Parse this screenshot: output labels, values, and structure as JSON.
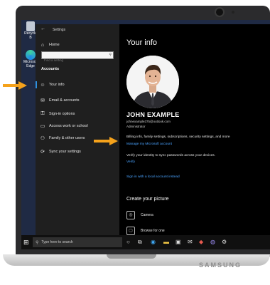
{
  "desktop": {
    "recycle_bin_label": "Recycle B",
    "edge_label": "Microsoft Edge"
  },
  "settings": {
    "window_title": "Settings",
    "nav": {
      "home_label": "Home",
      "search_placeholder": "Find a setting",
      "section_heading": "Accounts",
      "items": [
        {
          "label": "Your info",
          "icon": "person-card-icon"
        },
        {
          "label": "Email & accounts",
          "icon": "mail-icon"
        },
        {
          "label": "Sign-in options",
          "icon": "key-icon"
        },
        {
          "label": "Access work or school",
          "icon": "briefcase-icon"
        },
        {
          "label": "Family & other users",
          "icon": "people-icon"
        },
        {
          "label": "Sync your settings",
          "icon": "sync-icon"
        }
      ]
    },
    "content": {
      "title": "Your info",
      "user_name": "JOHN EXAMPLE",
      "user_email": "johnexample375@outlook.com",
      "user_role": "Administrator",
      "billing_text": "Billing info, family settings, subscriptions, security settings, and more",
      "manage_link": "Manage my Microsoft account",
      "verify_text": "Verify your identity to sync passwords across your devices.",
      "verify_link": "Verify",
      "local_link": "Sign in with a local account instead",
      "create_heading": "Create your picture",
      "camera_option": "Camera",
      "browse_option": "Browse for one"
    }
  },
  "taskbar": {
    "search_placeholder": "Type here to search"
  },
  "laptop": {
    "brand": "SAMSUNG"
  },
  "colors": {
    "accent_link": "#4aa3ff",
    "arrow": "#f5a21b",
    "window_bg": "#000000",
    "nav_bg": "#1f1f1f"
  }
}
